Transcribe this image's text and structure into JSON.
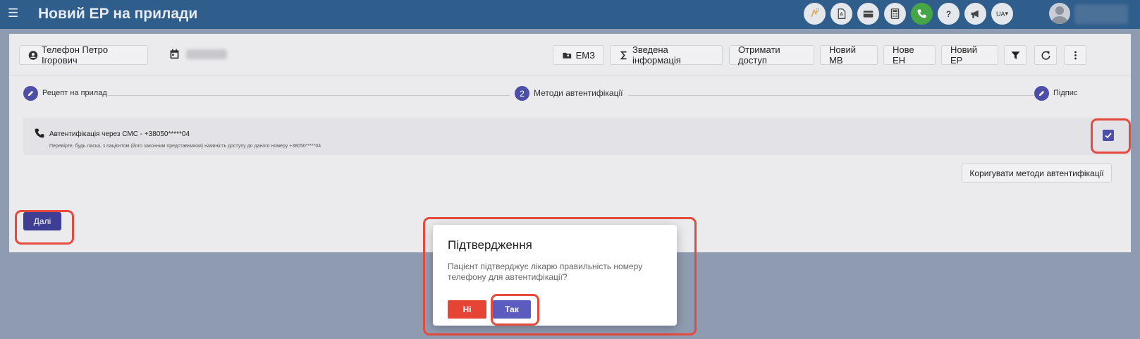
{
  "header": {
    "title": "Новий ЕР на прилади",
    "language": "UA",
    "icons": [
      "helsi-icon",
      "pdf-icon",
      "card-icon",
      "calculator-icon",
      "phone-icon",
      "help-icon",
      "megaphone-icon"
    ]
  },
  "toolbar": {
    "patient_name": "Телефон Петро Ігорович",
    "emz_label": "ЕМЗ",
    "summary_label": "Зведена інформація",
    "access_label": "Отримати доступ",
    "new_mv_label": "Новий МВ",
    "new_en_label": "Нове ЕН",
    "new_er_label": "Новий ЕР"
  },
  "stepper": {
    "steps": [
      {
        "label": "Рецепт на прилад",
        "state": "done"
      },
      {
        "label": "Методи автентифікації",
        "number": "2",
        "state": "active"
      },
      {
        "label": "Підпис",
        "state": "done"
      }
    ]
  },
  "auth": {
    "title": "Автентифікація через СМС - +38050*****04",
    "subtitle": "Перевірте, будь ласка, з пацієнтом (його законним представником) наявність доступу до даного номеру +38050*****04",
    "checked": true
  },
  "actions": {
    "edit_methods_label": "Коригувати методи автентифікації",
    "next_label": "Далі"
  },
  "dialog": {
    "title": "Підтвердження",
    "text": "Пацієнт підтверджує лікарю правильність номеру телефону для автентифікації?",
    "no_label": "Ні",
    "yes_label": "Так"
  },
  "colors": {
    "header_bg": "#2f5e8c",
    "accent": "#4d4ea6",
    "danger": "#e64434",
    "highlight": "#e64a3b"
  }
}
